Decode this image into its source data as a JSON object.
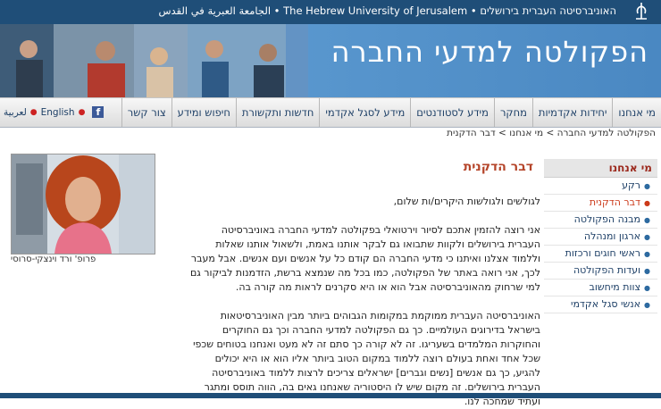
{
  "header": {
    "university": "האוניברסיטה העברית בירושלים • The Hebrew University of Jerusalem • האוניברסיטה העברית בירושלים",
    "university_display": "האוניברסיטה העברית בירושלים • The Hebrew University of Jerusalem • الجامعة العبرية في القدس"
  },
  "banner": {
    "title": "הפקולטה למדעי החברה"
  },
  "nav": {
    "items": [
      "מי אנחנו",
      "יחידות אקדמיות",
      "מחקר",
      "מידע לסטודנטים",
      "מידע לסגל אקדמי",
      "חדשות ותקשורת",
      "חיפוש ומידע",
      "צור קשר"
    ],
    "english": "English",
    "arabic": "لعربية",
    "facebook": "f"
  },
  "breadcrumb": "הפקולטה למדעי החברה > מי אנחנו > דבר הדקנית",
  "sidebar": {
    "title": "מי אנחנו",
    "items": [
      "רקע",
      "דבר הדקנית",
      "מבנה הפקולטה",
      "ארגון ומנהלה",
      "ראשי חוגים ורכזות",
      "ועדות הפקולטה",
      "צוות מיחשוב",
      "אנשי סגל אקדמי"
    ],
    "active_index": 1
  },
  "main": {
    "heading": "דבר הדקנית",
    "greeting": "לגולשים ולגולשות היקרים/ות שלום,",
    "para1": "אני רוצה להזמין אתכם לסיור וירטואלי בפקולטה למדעי החברה באוניברסיטה העברית בירושלים ולקוות שתבואו גם לבקר אותנו באמת, ולשאול אותנו שאלות וללמוד אצלנו ואיתנו כי מדעי החברה הם קודם כל על אנשים ועם אנשים. אבל מעבר לכך, אני רואה באתר של הפקולטה, כמו בכל מה שנמצא ברשת, הזדמנות לביקור גם למי שרחוק מהאוניברסיטה אבל הוא או היא סקרנים לראות מה קורה בה.",
    "para2": "האוניברסיטה העברית ממוקמת במקומות הגבוהים ביותר מבין האוניברסיטאות בישראל בדירוגים העולמיים. כך גם הפקולטה למדעי החברה וכך גם החוקרים והחוקרות המלמדים בשעריגו. זה לא קורה כך סתם זה לא מעט ואנחנו בטוחים שכפי שכל אחד ואחת בעולם רוצה ללמוד במקום הטוב ביותר אליו הוא או היא יכולים להגיע, כך גם אנשים [נשים וגברים] ישראלים צריכים לרצות ללמוד באוניברסיטה העברית בירושלים. זה מקום שיש לו היסטוריה שאנחנו גאים בה, הווה תוסס ומתגר ועתיד שמחכה לנו."
  },
  "profile": {
    "caption": "פרופ' ורד וינצקי-סרוסי"
  },
  "colors": {
    "topbar": "#1f4e78",
    "banner": "#5a98cf",
    "heading": "#b5452a",
    "link": "#1d3f66",
    "active": "#cc3a1a"
  }
}
